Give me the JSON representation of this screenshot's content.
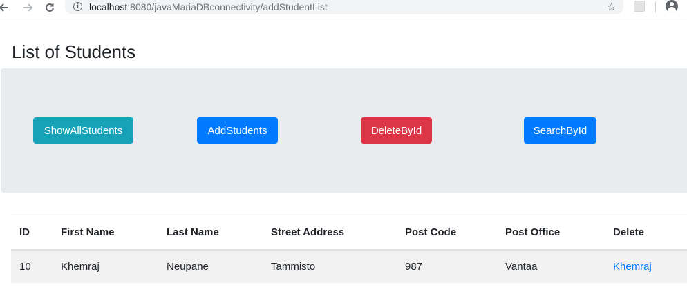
{
  "browser": {
    "url_host": "localhost",
    "url_rest": ":8080/javaMariaDBconnectivity/addStudentList",
    "icons": {
      "back": "arrow-left-icon",
      "forward": "arrow-right-icon",
      "reload": "reload-icon",
      "info": "info-icon",
      "star": "star-icon",
      "extension": "extension-icon",
      "profile": "profile-icon"
    }
  },
  "page": {
    "title": "List of Students"
  },
  "actions": {
    "show_all": "ShowAllStudents",
    "add": "AddStudents",
    "delete_by_id": "DeleteById",
    "search_by_id": "SearchById"
  },
  "colors": {
    "info": "#17a2b8",
    "primary": "#007bff",
    "danger": "#dc3545",
    "jumbotron": "#e9ecef"
  },
  "table": {
    "headers": [
      "ID",
      "First Name",
      "Last Name",
      "Street Address",
      "Post Code",
      "Post Office",
      "Delete"
    ],
    "rows": [
      {
        "id": "10",
        "first_name": "Khemraj",
        "last_name": "Neupane",
        "street_address": "Tammisto",
        "post_code": "987",
        "post_office": "Vantaa",
        "delete_link": "Khemraj"
      }
    ]
  }
}
